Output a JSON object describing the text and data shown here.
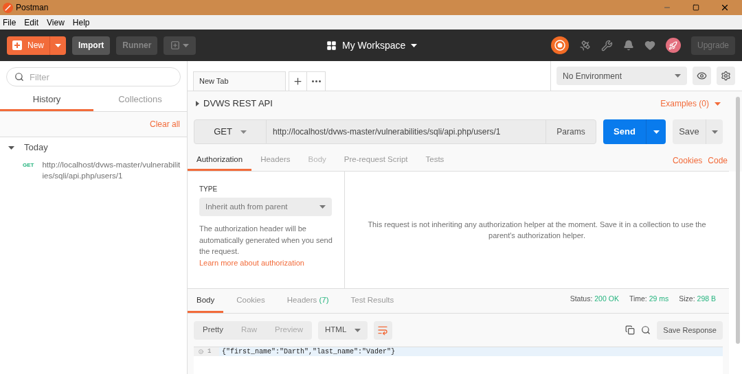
{
  "window": {
    "title": "Postman",
    "menu": [
      "File",
      "Edit",
      "View",
      "Help"
    ]
  },
  "toolbar": {
    "new": "New",
    "import": "Import",
    "runner": "Runner",
    "workspace": "My Workspace",
    "upgrade": "Upgrade"
  },
  "sidebar": {
    "filter_placeholder": "Filter",
    "tabs": [
      {
        "label": "History",
        "selected": true
      },
      {
        "label": "Collections",
        "selected": false
      }
    ],
    "clear_all": "Clear all",
    "groups": [
      {
        "label": "Today",
        "expanded": true,
        "children": [
          {
            "method": "GET",
            "url": "http://localhost/dvws-master/vulnerabilities/sqli/api.php/users/1"
          }
        ]
      }
    ]
  },
  "request_tabs": [
    {
      "label": "New Tab",
      "selected": true
    }
  ],
  "environment": "No Environment",
  "collection": {
    "name": "DVWS REST API",
    "examples": "Examples (0)"
  },
  "request": {
    "method": "GET",
    "url": "http://localhost/dvws-master/vulnerabilities/sqli/api.php/users/1",
    "params": "Params",
    "send": "Send",
    "save": "Save"
  },
  "request_sections": [
    {
      "label": "Authorization",
      "selected": true,
      "disabled": false
    },
    {
      "label": "Headers",
      "selected": false,
      "disabled": false
    },
    {
      "label": "Body",
      "selected": false,
      "disabled": true
    },
    {
      "label": "Pre-request Script",
      "selected": false,
      "disabled": false
    },
    {
      "label": "Tests",
      "selected": false,
      "disabled": false
    }
  ],
  "links": [
    "Cookies",
    "Code"
  ],
  "auth": {
    "type_label": "TYPE",
    "type": "Inherit auth from parent",
    "description": "The authorization header will be automatically generated when you send the request.",
    "learn_more": "Learn more about authorization",
    "message": "This request is not inheriting any authorization helper at the moment. Save it in a collection to use the parent's authorization helper."
  },
  "response": {
    "tabs": [
      {
        "label": "Body",
        "selected": true
      },
      {
        "label": "Cookies",
        "selected": false
      },
      {
        "label": "Headers",
        "count": "(7)",
        "selected": false
      },
      {
        "label": "Test Results",
        "selected": false
      }
    ],
    "stats": [
      {
        "label": "Status:",
        "value": "200 OK"
      },
      {
        "label": "Time:",
        "value": "29 ms"
      },
      {
        "label": "Size:",
        "value": "298 B"
      }
    ],
    "views": [
      {
        "label": "Pretty",
        "selected": true
      },
      {
        "label": "Raw",
        "selected": false
      },
      {
        "label": "Preview",
        "selected": false
      }
    ],
    "format": "HTML",
    "save": "Save Response",
    "lines": [
      {
        "number": "1",
        "text": "{\"first_name\":\"Darth\",\"last_name\":\"Vader\"}"
      }
    ]
  }
}
